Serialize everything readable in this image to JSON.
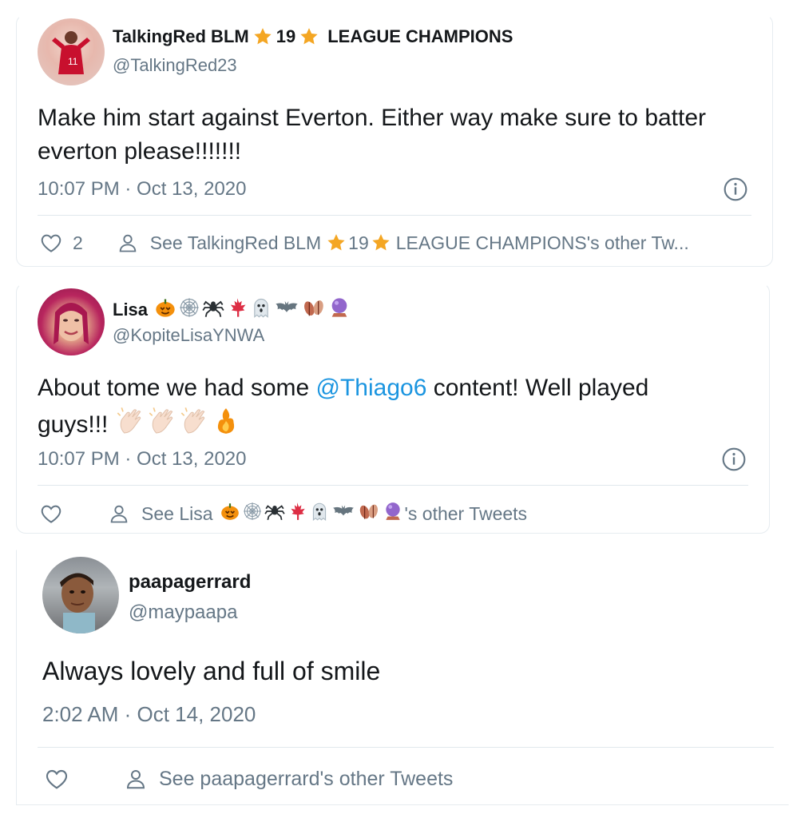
{
  "tweets": [
    {
      "display_name": "TalkingRed BLM",
      "name_number": "19",
      "name_suffix": "LEAGUE CHAMPIONS",
      "handle": "@TalkingRed23",
      "text": "Make him start against Everton. Either way make sure to batter everton please!!!!!!!",
      "timestamp": "10:07 PM · Oct 13, 2020",
      "like_count": "2",
      "see_other_prefix": "See TalkingRed BLM",
      "see_other_number": "19",
      "see_other_suffix": "LEAGUE CHAMPIONS's other Tw...",
      "colors": {
        "star": "#f4a623",
        "avatar_bg": "#c8102e"
      }
    },
    {
      "display_name": "Lisa",
      "handle": "@KopiteLisaYNWA",
      "text_before": "About tome we had some ",
      "mention": "@Thiago6",
      "text_after": " content! Well played guys!!! ",
      "text_emojis": [
        "clapping-hands",
        "clapping-hands",
        "clapping-hands",
        "fire"
      ],
      "name_emojis": [
        "pumpkin",
        "spider-web",
        "spider",
        "maple-leaf",
        "ghost",
        "bat",
        "fallen-leaves",
        "crystal-ball"
      ],
      "timestamp": "10:07 PM · Oct 13, 2020",
      "see_other_prefix": "See Lisa",
      "see_other_suffix": "'s other Tweets"
    },
    {
      "display_name": "paapagerrard",
      "handle": "@maypaapa",
      "text": "Always lovely and full of smile",
      "timestamp": "2:02 AM · Oct 14, 2020",
      "see_other": "See paapagerrard's other Tweets"
    }
  ],
  "icons": {
    "like": "heart-outline-icon",
    "profile": "person-outline-icon",
    "info": "info-circle-icon"
  },
  "colors": {
    "text_primary": "#14171a",
    "text_secondary": "#657786",
    "link": "#1b95e0",
    "border": "#e6ecf0"
  }
}
